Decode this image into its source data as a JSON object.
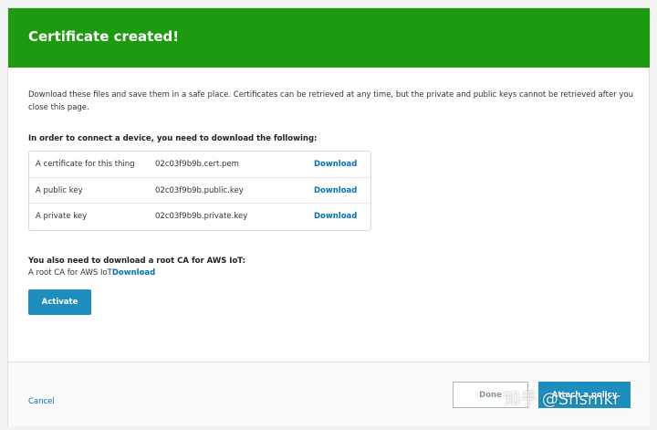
{
  "header": {
    "title": "Certificate created!"
  },
  "intro_text": "Download these files and save them in a safe place. Certificates can be retrieved at any time, but the private and public keys cannot be retrieved after you close this page.",
  "requirement_heading": "In order to connect a device, you need to download the following:",
  "files": [
    {
      "description": "A certificate for this thing",
      "filename": "02c03f9b9b.cert.pem",
      "link": "Download"
    },
    {
      "description": "A public key",
      "filename": "02c03f9b9b.public.key",
      "link": "Download"
    },
    {
      "description": "A private key",
      "filename": "02c03f9b9b.private.key",
      "link": "Download"
    }
  ],
  "root_ca": {
    "heading": "You also need to download a root CA for AWS IoT:",
    "label": "A root CA for AWS IoT",
    "link": "Download"
  },
  "activate_label": "Activate",
  "footer": {
    "cancel_label": "Cancel",
    "done_label": "Done",
    "attach_label": "Attach a policy"
  },
  "watermark": "知乎 @Snsmkr",
  "colors": {
    "header_bg": "#1d9a10",
    "primary_button": "#1d8ebd",
    "link": "#0073bb"
  }
}
